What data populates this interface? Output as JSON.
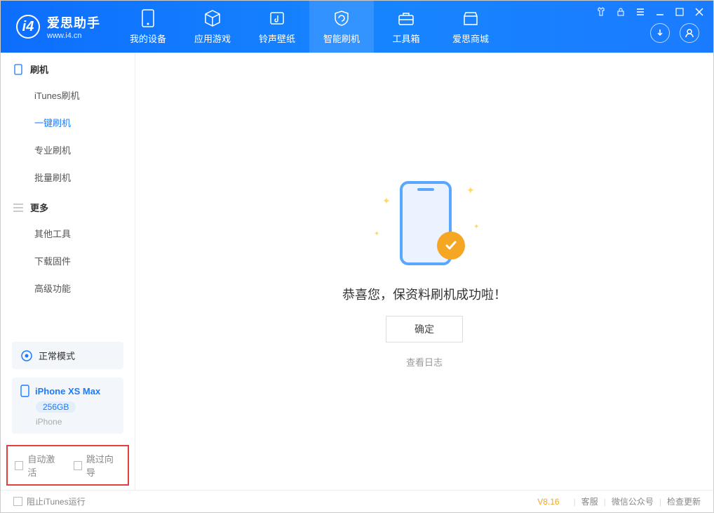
{
  "app": {
    "name": "爱思助手",
    "url": "www.i4.cn"
  },
  "nav": [
    {
      "label": "我的设备"
    },
    {
      "label": "应用游戏"
    },
    {
      "label": "铃声壁纸"
    },
    {
      "label": "智能刷机"
    },
    {
      "label": "工具箱"
    },
    {
      "label": "爱思商城"
    }
  ],
  "sidebar": {
    "section1_title": "刷机",
    "items1": [
      "iTunes刷机",
      "一键刷机",
      "专业刷机",
      "批量刷机"
    ],
    "section2_title": "更多",
    "items2": [
      "其他工具",
      "下载固件",
      "高级功能"
    ]
  },
  "mode": {
    "label": "正常模式"
  },
  "device": {
    "name": "iPhone XS Max",
    "capacity": "256GB",
    "type": "iPhone"
  },
  "main": {
    "success_text": "恭喜您，保资料刷机成功啦！",
    "ok_button": "确定",
    "view_log": "查看日志"
  },
  "bottom_options": {
    "auto_activate": "自动激活",
    "skip_guide": "跳过向导"
  },
  "footer": {
    "block_itunes": "阻止iTunes运行",
    "version": "V8.16",
    "links": [
      "客服",
      "微信公众号",
      "检查更新"
    ]
  }
}
